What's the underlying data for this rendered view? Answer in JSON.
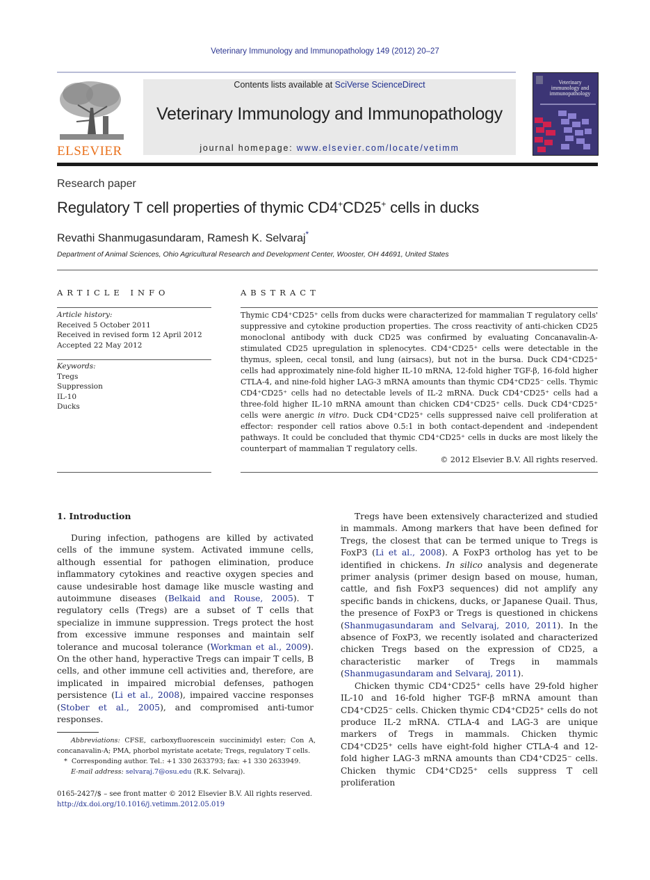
{
  "header": {
    "citation": "Veterinary Immunology and Immunopathology 149 (2012) 20–27",
    "publisher_logo_text": "ELSEVIER",
    "contents_prefix": "Contents lists available at ",
    "contents_link": "SciVerse ScienceDirect",
    "journal_name": "Veterinary Immunology and Immunopathology",
    "homepage_prefix": "journal homepage: ",
    "homepage_link": "www.elsevier.com/locate/vetimm",
    "cover_title": "Veterinary immunology and immunopathology",
    "colors": {
      "link": "#2b3590",
      "elsevier_orange": "#e9711c",
      "banner_bg": "#e9e9e9",
      "cover_bg": "#3c3575"
    }
  },
  "article": {
    "type": "Research paper",
    "title_parts": [
      "Regulatory T cell properties of thymic CD4",
      "+",
      "CD25",
      "+",
      " cells in ducks"
    ],
    "authors": "Revathi Shanmugasundaram, Ramesh K. Selvaraj",
    "author_mark": "*",
    "affiliation": "Department of Animal Sciences, Ohio Agricultural Research and Development Center, Wooster, OH 44691, United States"
  },
  "article_info": {
    "heading": "ARTICLE INFO",
    "history_label": "Article history:",
    "history": [
      "Received 5 October 2011",
      "Received in revised form 12 April 2012",
      "Accepted 22 May 2012"
    ],
    "keywords_label": "Keywords:",
    "keywords": [
      "Tregs",
      "Suppression",
      "IL-10",
      "Ducks"
    ]
  },
  "abstract": {
    "heading": "ABSTRACT",
    "text_a": "Thymic CD4⁺CD25⁺ cells from ducks were characterized for mammalian T regulatory cells' suppressive and cytokine production properties. The cross reactivity of anti-chicken CD25 monoclonal antibody with duck CD25 was confirmed by evaluating Concanavalin-A-stimulated CD25 upregulation in splenocytes. CD4⁺CD25⁺ cells were detectable in the thymus, spleen, cecal tonsil, and lung (airsacs), but not in the bursa. Duck CD4⁺CD25⁺ cells had approximately nine-fold higher IL-10 mRNA, 12-fold higher TGF-β, 16-fold higher CTLA-4, and nine-fold higher LAG-3 mRNA amounts than thymic CD4⁺CD25⁻ cells. Thymic CD4⁺CD25⁺ cells had no detectable levels of IL-2 mRNA. Duck CD4⁺CD25⁺ cells had a three-fold higher IL-10 mRNA amount than chicken CD4⁺CD25⁺ cells. Duck CD4⁺CD25⁺ cells were anergic ",
    "text_italic": "in vitro",
    "text_b": ". Duck CD4⁺CD25⁺ cells suppressed naive cell proliferation at effector: responder cell ratios above 0.5:1 in both contact-dependent and -independent pathways. It could be concluded that thymic CD4⁺CD25⁺ cells in ducks are most likely the counterpart of mammalian T regulatory cells.",
    "copyright": "© 2012 Elsevier B.V. All rights reserved."
  },
  "introduction": {
    "heading": "1.  Introduction",
    "left_p1": [
      {
        "t": "During infection, pathogens are killed by activated cells of the immune system. Activated immune cells, although essential for pathogen elimination, produce inflammatory cytokines and reactive oxygen species and cause undesirable host damage like muscle wasting and autoimmune diseases ("
      },
      {
        "t": "Belkaid and Rouse, 2005",
        "link": true
      },
      {
        "t": "). T regulatory cells (Tregs) are a subset of T cells that specialize in immune suppression. Tregs protect the host from excessive immune responses and maintain self tolerance and mucosal tolerance ("
      },
      {
        "t": "Workman et al., 2009",
        "link": true
      },
      {
        "t": "). On the other hand, hyperactive Tregs can impair T cells, B cells, and other immune cell activities and, therefore, are implicated in impaired microbial defenses, pathogen persistence ("
      },
      {
        "t": "Li et al., 2008",
        "link": true
      },
      {
        "t": "), impaired vaccine responses ("
      },
      {
        "t": "Stober et al., 2005",
        "link": true
      },
      {
        "t": "), and compromised anti-tumor responses."
      }
    ],
    "right_p1": [
      {
        "t": "Tregs have been extensively characterized and studied in mammals. Among markers that have been defined for Tregs, the closest that can be termed unique to Tregs is FoxP3 ("
      },
      {
        "t": "Li et al., 2008",
        "link": true
      },
      {
        "t": "). A FoxP3 ortholog has yet to be identified in chickens. "
      },
      {
        "t": "In silico",
        "italic": true
      },
      {
        "t": " analysis and degenerate primer analysis (primer design based on mouse, human, cattle, and fish FoxP3 sequences) did not amplify any specific bands in chickens, ducks, or Japanese Quail. Thus, the presence of FoxP3 or Tregs is questioned in chickens ("
      },
      {
        "t": "Shanmugasundaram and Selvaraj, 2010, 2011",
        "link": true
      },
      {
        "t": "). In the absence of FoxP3, we recently isolated and characterized chicken Tregs based on the expression of CD25, a characteristic marker of Tregs in mammals ("
      },
      {
        "t": "Shanmugasundaram and Selvaraj, 2011",
        "link": true
      },
      {
        "t": ")."
      }
    ],
    "right_p2": [
      {
        "t": "Chicken thymic CD4⁺CD25⁺ cells have 29-fold higher IL-10 and 16-fold higher TGF-β mRNA amount than CD4⁺CD25⁻ cells. Chicken thymic CD4⁺CD25⁺ cells do not produce IL-2 mRNA. CTLA-4 and LAG-3 are unique markers of Tregs in mammals. Chicken thymic CD4⁺CD25⁺ cells have eight-fold higher CTLA-4 and 12-fold higher LAG-3 mRNA amounts than CD4⁺CD25⁻ cells. Chicken thymic CD4⁺CD25⁺ cells suppress T cell proliferation"
      }
    ]
  },
  "footnotes": {
    "abbrev_label": "Abbreviations:",
    "abbrev_text": "  CFSE, carboxyfluorescein succinimidyl ester; Con A, concanavalin-A; PMA, phorbol myristate acetate; Tregs, regulatory T cells.",
    "corr_mark": "*",
    "corr_text": "Corresponding author. Tel.: +1 330 2633793; fax: +1 330 2633949.",
    "email_label": "E-mail address:",
    "email": "selvaraj.7@osu.edu",
    "email_suffix": " (R.K. Selvaraj)."
  },
  "front_matter": {
    "issn_line": "0165-2427/$ – see front matter © 2012 Elsevier B.V. All rights reserved.",
    "doi": "http://dx.doi.org/10.1016/j.vetimm.2012.05.019"
  }
}
